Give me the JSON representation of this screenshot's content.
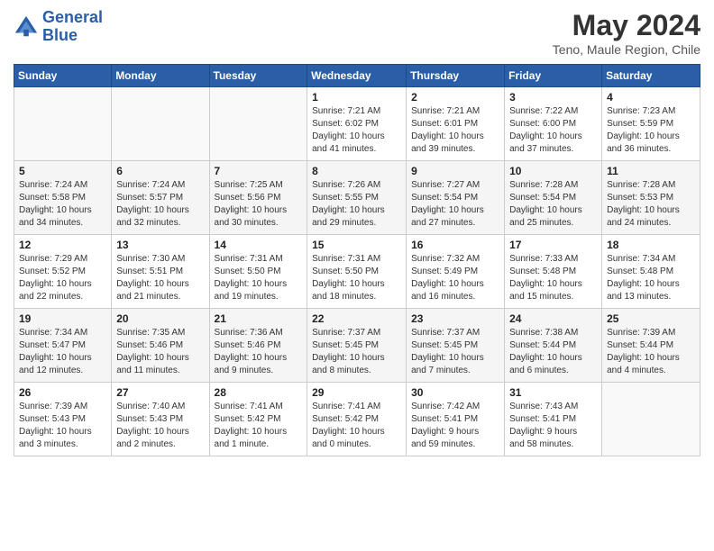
{
  "logo": {
    "line1": "General",
    "line2": "Blue"
  },
  "title": "May 2024",
  "location": "Teno, Maule Region, Chile",
  "days_of_week": [
    "Sunday",
    "Monday",
    "Tuesday",
    "Wednesday",
    "Thursday",
    "Friday",
    "Saturday"
  ],
  "weeks": [
    {
      "days": [
        {
          "num": "",
          "info": ""
        },
        {
          "num": "",
          "info": ""
        },
        {
          "num": "",
          "info": ""
        },
        {
          "num": "1",
          "info": "Sunrise: 7:21 AM\nSunset: 6:02 PM\nDaylight: 10 hours\nand 41 minutes."
        },
        {
          "num": "2",
          "info": "Sunrise: 7:21 AM\nSunset: 6:01 PM\nDaylight: 10 hours\nand 39 minutes."
        },
        {
          "num": "3",
          "info": "Sunrise: 7:22 AM\nSunset: 6:00 PM\nDaylight: 10 hours\nand 37 minutes."
        },
        {
          "num": "4",
          "info": "Sunrise: 7:23 AM\nSunset: 5:59 PM\nDaylight: 10 hours\nand 36 minutes."
        }
      ]
    },
    {
      "days": [
        {
          "num": "5",
          "info": "Sunrise: 7:24 AM\nSunset: 5:58 PM\nDaylight: 10 hours\nand 34 minutes."
        },
        {
          "num": "6",
          "info": "Sunrise: 7:24 AM\nSunset: 5:57 PM\nDaylight: 10 hours\nand 32 minutes."
        },
        {
          "num": "7",
          "info": "Sunrise: 7:25 AM\nSunset: 5:56 PM\nDaylight: 10 hours\nand 30 minutes."
        },
        {
          "num": "8",
          "info": "Sunrise: 7:26 AM\nSunset: 5:55 PM\nDaylight: 10 hours\nand 29 minutes."
        },
        {
          "num": "9",
          "info": "Sunrise: 7:27 AM\nSunset: 5:54 PM\nDaylight: 10 hours\nand 27 minutes."
        },
        {
          "num": "10",
          "info": "Sunrise: 7:28 AM\nSunset: 5:54 PM\nDaylight: 10 hours\nand 25 minutes."
        },
        {
          "num": "11",
          "info": "Sunrise: 7:28 AM\nSunset: 5:53 PM\nDaylight: 10 hours\nand 24 minutes."
        }
      ]
    },
    {
      "days": [
        {
          "num": "12",
          "info": "Sunrise: 7:29 AM\nSunset: 5:52 PM\nDaylight: 10 hours\nand 22 minutes."
        },
        {
          "num": "13",
          "info": "Sunrise: 7:30 AM\nSunset: 5:51 PM\nDaylight: 10 hours\nand 21 minutes."
        },
        {
          "num": "14",
          "info": "Sunrise: 7:31 AM\nSunset: 5:50 PM\nDaylight: 10 hours\nand 19 minutes."
        },
        {
          "num": "15",
          "info": "Sunrise: 7:31 AM\nSunset: 5:50 PM\nDaylight: 10 hours\nand 18 minutes."
        },
        {
          "num": "16",
          "info": "Sunrise: 7:32 AM\nSunset: 5:49 PM\nDaylight: 10 hours\nand 16 minutes."
        },
        {
          "num": "17",
          "info": "Sunrise: 7:33 AM\nSunset: 5:48 PM\nDaylight: 10 hours\nand 15 minutes."
        },
        {
          "num": "18",
          "info": "Sunrise: 7:34 AM\nSunset: 5:48 PM\nDaylight: 10 hours\nand 13 minutes."
        }
      ]
    },
    {
      "days": [
        {
          "num": "19",
          "info": "Sunrise: 7:34 AM\nSunset: 5:47 PM\nDaylight: 10 hours\nand 12 minutes."
        },
        {
          "num": "20",
          "info": "Sunrise: 7:35 AM\nSunset: 5:46 PM\nDaylight: 10 hours\nand 11 minutes."
        },
        {
          "num": "21",
          "info": "Sunrise: 7:36 AM\nSunset: 5:46 PM\nDaylight: 10 hours\nand 9 minutes."
        },
        {
          "num": "22",
          "info": "Sunrise: 7:37 AM\nSunset: 5:45 PM\nDaylight: 10 hours\nand 8 minutes."
        },
        {
          "num": "23",
          "info": "Sunrise: 7:37 AM\nSunset: 5:45 PM\nDaylight: 10 hours\nand 7 minutes."
        },
        {
          "num": "24",
          "info": "Sunrise: 7:38 AM\nSunset: 5:44 PM\nDaylight: 10 hours\nand 6 minutes."
        },
        {
          "num": "25",
          "info": "Sunrise: 7:39 AM\nSunset: 5:44 PM\nDaylight: 10 hours\nand 4 minutes."
        }
      ]
    },
    {
      "days": [
        {
          "num": "26",
          "info": "Sunrise: 7:39 AM\nSunset: 5:43 PM\nDaylight: 10 hours\nand 3 minutes."
        },
        {
          "num": "27",
          "info": "Sunrise: 7:40 AM\nSunset: 5:43 PM\nDaylight: 10 hours\nand 2 minutes."
        },
        {
          "num": "28",
          "info": "Sunrise: 7:41 AM\nSunset: 5:42 PM\nDaylight: 10 hours\nand 1 minute."
        },
        {
          "num": "29",
          "info": "Sunrise: 7:41 AM\nSunset: 5:42 PM\nDaylight: 10 hours\nand 0 minutes."
        },
        {
          "num": "30",
          "info": "Sunrise: 7:42 AM\nSunset: 5:41 PM\nDaylight: 9 hours\nand 59 minutes."
        },
        {
          "num": "31",
          "info": "Sunrise: 7:43 AM\nSunset: 5:41 PM\nDaylight: 9 hours\nand 58 minutes."
        },
        {
          "num": "",
          "info": ""
        }
      ]
    }
  ]
}
